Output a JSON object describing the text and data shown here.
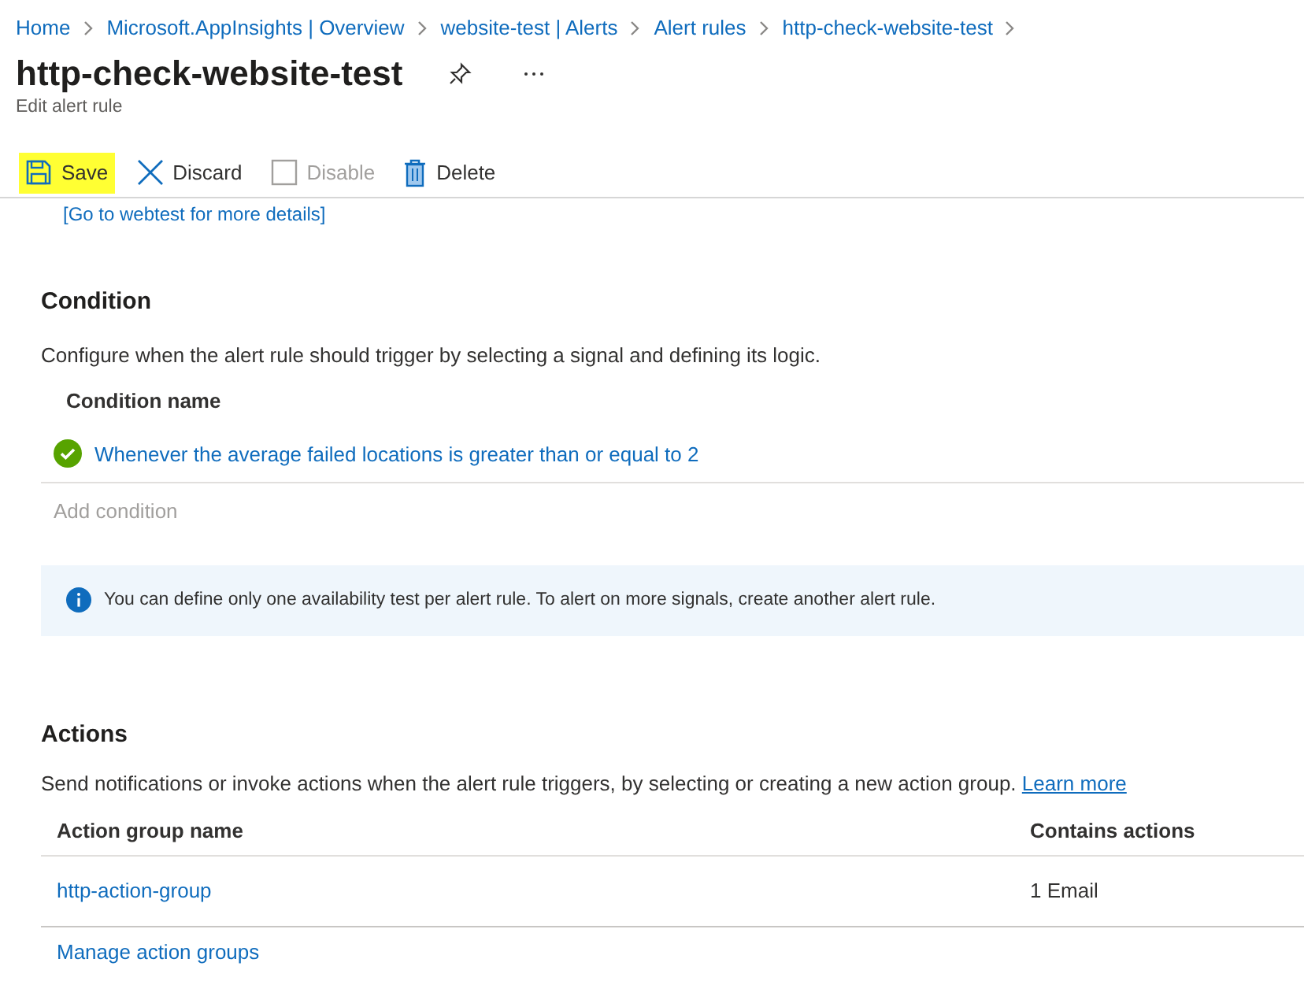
{
  "breadcrumb": [
    "Home",
    "Microsoft.AppInsights | Overview",
    "website-test | Alerts",
    "Alert rules",
    "http-check-website-test"
  ],
  "page": {
    "title": "http-check-website-test",
    "subtitle": "Edit alert rule"
  },
  "toolbar": [
    {
      "kind": "save",
      "label": "Save",
      "disabled": false,
      "highlighted": true
    },
    {
      "kind": "discard",
      "label": "Discard",
      "disabled": false,
      "highlighted": false
    },
    {
      "kind": "disable",
      "label": "Disable",
      "disabled": true,
      "highlighted": false
    },
    {
      "kind": "delete",
      "label": "Delete",
      "disabled": false,
      "highlighted": false
    }
  ],
  "webtest_link": "[Go to webtest for more details]",
  "condition": {
    "heading": "Condition",
    "description": "Configure when the alert rule should trigger by selecting a signal and defining its logic.",
    "column": "Condition name",
    "rows": [
      {
        "name": "Whenever the average failed locations is greater than or equal to 2",
        "valid": true
      }
    ],
    "add": {
      "label": "Add condition",
      "disabled": true
    },
    "info": "You can define only one availability test per alert rule. To alert on more signals, create another alert rule."
  },
  "actions": {
    "heading": "Actions",
    "description": "Send notifications or invoke actions when the alert rule triggers, by selecting or creating a new action group.",
    "learn_more": "Learn more",
    "columns": [
      "Action group name",
      "Contains actions"
    ],
    "rows": [
      {
        "name": "http-action-group",
        "contains": "1 Email"
      }
    ],
    "manage": "Manage action groups"
  }
}
